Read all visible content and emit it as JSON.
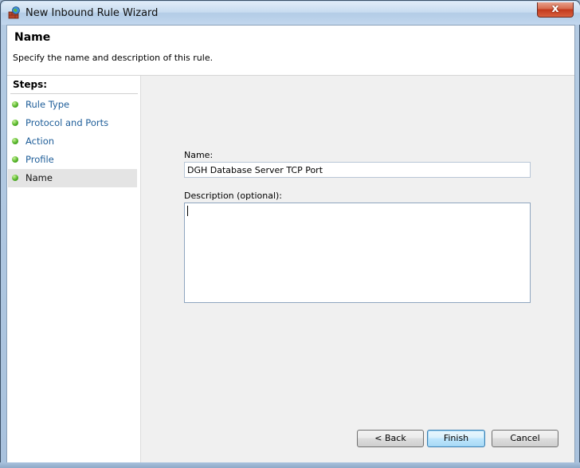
{
  "window": {
    "title": "New Inbound Rule Wizard",
    "close_label": "x"
  },
  "header": {
    "title": "Name",
    "subtitle": "Specify the name and description of this rule."
  },
  "steps": {
    "heading": "Steps:",
    "items": [
      {
        "label": "Rule Type"
      },
      {
        "label": "Protocol and Ports"
      },
      {
        "label": "Action"
      },
      {
        "label": "Profile"
      },
      {
        "label": "Name"
      }
    ],
    "active_index": 4
  },
  "form": {
    "name_label": "Name:",
    "name_value": "DGH Database Server TCP Port",
    "description_label": "Description (optional):",
    "description_value": ""
  },
  "buttons": {
    "back": "< Back",
    "finish": "Finish",
    "cancel": "Cancel"
  },
  "colors": {
    "link": "#1f5e99",
    "step_dot": "#56b62a",
    "active_step_bg": "#e4e4e4"
  }
}
